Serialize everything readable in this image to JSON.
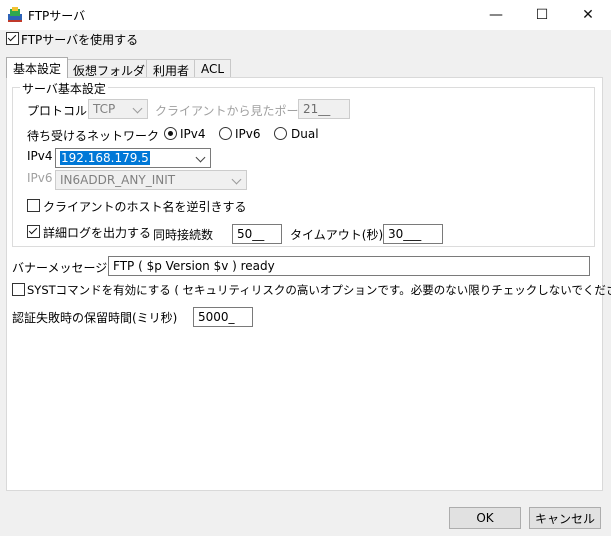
{
  "window": {
    "title": "FTPサーバ",
    "icon": "ftp-app-icon",
    "controls": {
      "minimize": "—",
      "maximize": "☐",
      "close": "✕"
    }
  },
  "enable_ftp": {
    "label": "FTPサーバを使用する",
    "checked": true
  },
  "tabs": [
    {
      "label": "基本設定",
      "active": true
    },
    {
      "label": "仮想フォルダ",
      "active": false
    },
    {
      "label": "利用者",
      "active": false
    },
    {
      "label": "ACL",
      "active": false
    }
  ],
  "server_group": {
    "title": "サーバ基本設定",
    "protocol_label": "プロトコル",
    "protocol_value": "TCP",
    "client_port_label": "クライアントから見たポート",
    "client_port_value": "21__",
    "network_label": "待ち受けるネットワーク",
    "network_options": [
      "IPv4",
      "IPv6",
      "Dual"
    ],
    "network_selected": "IPv4",
    "ipv4_label": "IPv4",
    "ipv4_value": "192.168.179.5",
    "ipv6_label": "IPv6",
    "ipv6_value": "IN6ADDR_ANY_INIT",
    "reverse_lookup_label": "クライアントのホスト名を逆引きする",
    "reverse_lookup_checked": false,
    "detail_log_label": "詳細ログを出力する",
    "detail_log_checked": true,
    "concurrent_label": "同時接続数",
    "concurrent_value": "50__",
    "timeout_label": "タイムアウト(秒)",
    "timeout_value": "30___"
  },
  "banner": {
    "label": "バナーメッセージ",
    "value": "FTP ( $p Version $v ) ready"
  },
  "syst": {
    "label": "SYSTコマンドを有効にする ( セキュリティリスクの高いオプションです。必要のない限りチェックしないでください。)",
    "checked": false
  },
  "auth_fail": {
    "label": "認証失敗時の保留時間(ミリ秒)",
    "value": "5000_"
  },
  "buttons": {
    "ok": "OK",
    "cancel": "キャンセル"
  },
  "colors": {
    "selection": "#0078d7",
    "panel": "#ffffff",
    "background": "#f0f0f0"
  }
}
